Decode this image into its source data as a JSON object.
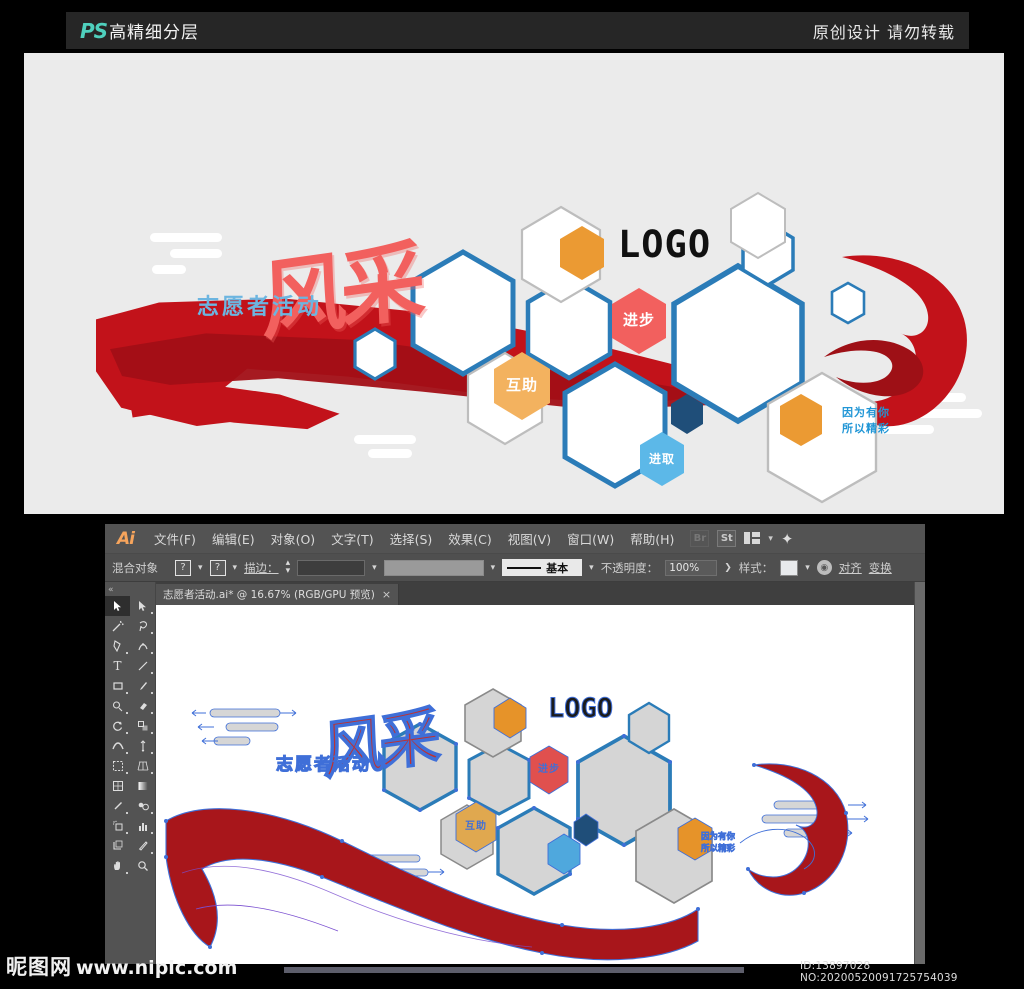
{
  "topbar": {
    "brand_mark": "PS",
    "brand_text": "高精细分层",
    "right_note": "原创设计 请勿转载",
    "brand_color": "#4fd0bd"
  },
  "preview": {
    "title_main": "风采",
    "title_sub": "志愿者活动",
    "logo_text": "LOGO",
    "slogan_line1": "因为有你",
    "slogan_line2": "所以精彩",
    "hex_labels": {
      "progress": "进步",
      "mutual_aid": "互助",
      "enterprising": "进取"
    },
    "colors": {
      "background": "#ebebeb",
      "hex_outline": "#2b7cb8",
      "ribbon_red": "#c2121a",
      "ribbon_dark_red": "#a20f16",
      "pink": "#f2605e",
      "orange": "#eb9a33",
      "light_orange": "#f3b25f",
      "light_blue": "#5cb8e8",
      "dark_blue": "#1f4e79",
      "title_blue": "#6cb5e0"
    }
  },
  "illustrator": {
    "app_mark": "Ai",
    "menus": [
      {
        "label": "文件(F)"
      },
      {
        "label": "编辑(E)"
      },
      {
        "label": "对象(O)"
      },
      {
        "label": "文字(T)"
      },
      {
        "label": "选择(S)"
      },
      {
        "label": "效果(C)"
      },
      {
        "label": "视图(V)"
      },
      {
        "label": "窗口(W)"
      },
      {
        "label": "帮助(H)"
      }
    ],
    "menu_buttons": [
      {
        "label": "Br",
        "name": "bridge-button"
      },
      {
        "label": "St",
        "name": "stock-button"
      }
    ],
    "control_bar": {
      "object_type": "混合对象",
      "q1": "?",
      "q2": "?",
      "stroke_label": "描边：",
      "stroke_profile": "基本",
      "opacity_label": "不透明度：",
      "opacity_value": "100%",
      "style_label": "样式：",
      "align_label": "对齐",
      "transform_label": "变换"
    },
    "document_tab": {
      "title": "志愿者活动.ai* @ 16.67% (RGB/GPU 预览)",
      "close": "×"
    },
    "tools": [
      {
        "name": "selection-tool",
        "glyph": "selection"
      },
      {
        "name": "direct-selection-tool",
        "glyph": "direct"
      },
      {
        "name": "magic-wand-tool",
        "glyph": "wand"
      },
      {
        "name": "lasso-tool",
        "glyph": "lasso"
      },
      {
        "name": "pen-tool",
        "glyph": "pen"
      },
      {
        "name": "curvature-tool",
        "glyph": "curvature"
      },
      {
        "name": "type-tool",
        "glyph": "T"
      },
      {
        "name": "line-segment-tool",
        "glyph": "line"
      },
      {
        "name": "rectangle-tool",
        "glyph": "rect"
      },
      {
        "name": "paintbrush-tool",
        "glyph": "brush"
      },
      {
        "name": "shaper-tool",
        "glyph": "shaper"
      },
      {
        "name": "eraser-tool",
        "glyph": "eraser"
      },
      {
        "name": "rotate-tool",
        "glyph": "rotate"
      },
      {
        "name": "scale-tool",
        "glyph": "scale"
      },
      {
        "name": "width-tool",
        "glyph": "width"
      },
      {
        "name": "free-transform-tool",
        "glyph": "pin"
      },
      {
        "name": "shape-builder-tool",
        "glyph": "shapebuild"
      },
      {
        "name": "perspective-grid-tool",
        "glyph": "perspective"
      },
      {
        "name": "mesh-tool",
        "glyph": "mesh"
      },
      {
        "name": "gradient-tool",
        "glyph": "gradient"
      },
      {
        "name": "eyedropper-tool",
        "glyph": "eyedropper"
      },
      {
        "name": "blend-tool",
        "glyph": "blend"
      },
      {
        "name": "symbol-sprayer-tool",
        "glyph": "sprayer"
      },
      {
        "name": "column-graph-tool",
        "glyph": "graph"
      },
      {
        "name": "artboard-tool",
        "glyph": "artboard"
      },
      {
        "name": "slice-tool",
        "glyph": "slice"
      },
      {
        "name": "hand-tool",
        "glyph": "hand"
      },
      {
        "name": "zoom-tool",
        "glyph": "zoom"
      }
    ]
  },
  "watermark": {
    "site_cn": "昵图网",
    "site_url": "www.nipic.com",
    "id_text": "ID:13897028 NO:20200520091725754039"
  }
}
